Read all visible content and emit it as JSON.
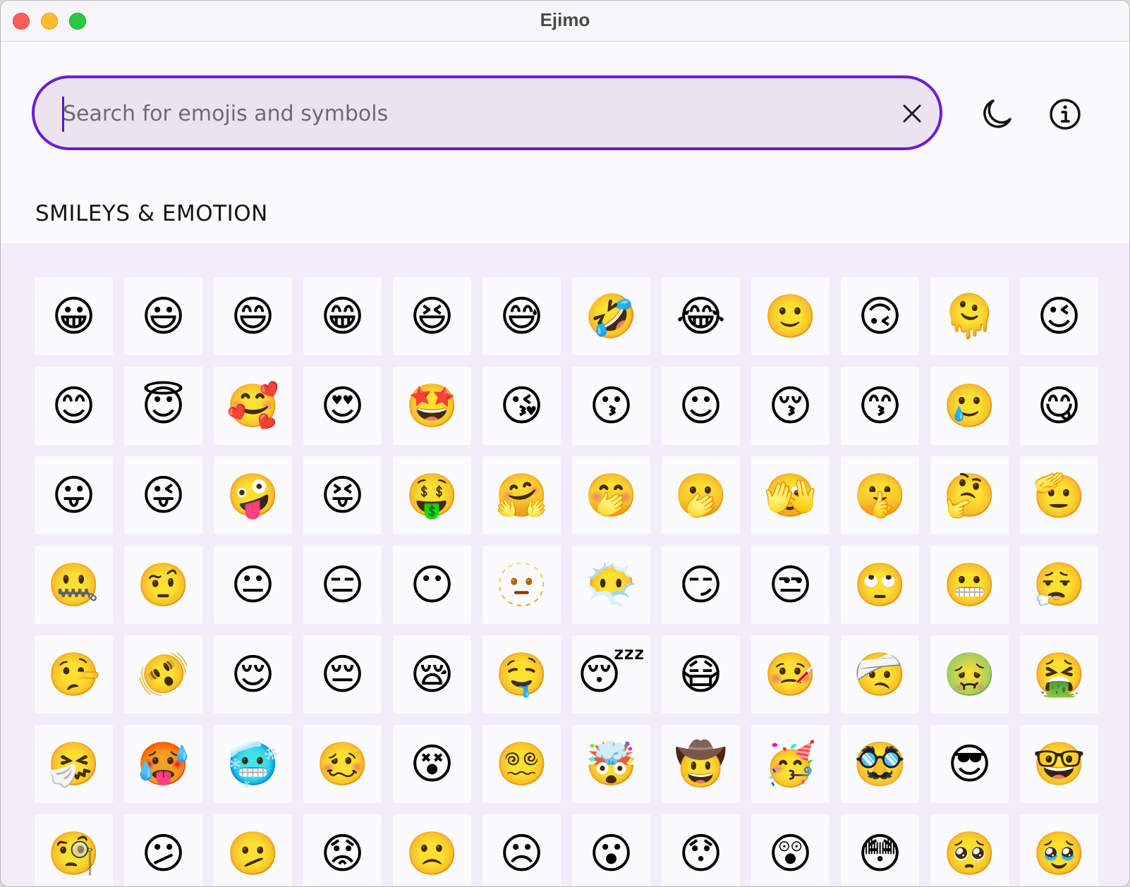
{
  "window": {
    "title": "Ejimo"
  },
  "search": {
    "placeholder": "Search for emojis and symbols",
    "value": ""
  },
  "section": {
    "title": "SMILEYS & EMOTION"
  },
  "accent_color": "#6a1bdc",
  "icons": {
    "clear": "close-icon",
    "theme": "moon-icon",
    "info": "info-icon"
  },
  "emojis": [
    "😀",
    "😃",
    "😄",
    "😁",
    "😆",
    "😅",
    "🤣",
    "😂",
    "🙂",
    "🙃",
    "🫠",
    "😉",
    "😊",
    "😇",
    "🥰",
    "😍",
    "🤩",
    "😘",
    "😗",
    "☺",
    "😚",
    "😙",
    "🥲",
    "😋",
    "😛",
    "😜",
    "🤪",
    "😝",
    "🤑",
    "🤗",
    "🤭",
    "🫢",
    "🫣",
    "🤫",
    "🤔",
    "🫡",
    "🤐",
    "🤨",
    "😐",
    "😑",
    "😶",
    "🫥",
    "😶‍🌫️",
    "😏",
    "😒",
    "🙄",
    "😬",
    "😮‍💨",
    "🤥",
    "🫨",
    "😌",
    "😔",
    "😪",
    "🤤",
    "😴",
    "😷",
    "🤒",
    "🤕",
    "🤢",
    "🤮",
    "🤧",
    "🥵",
    "🥶",
    "🥴",
    "😵",
    "😵‍💫",
    "🤯",
    "🤠",
    "🥳",
    "🥸",
    "😎",
    "🤓",
    "🧐",
    "😕",
    "🫤",
    "😟",
    "🙁",
    "☹",
    "😮",
    "😯",
    "😲",
    "😳",
    "🥺",
    "🥹"
  ]
}
